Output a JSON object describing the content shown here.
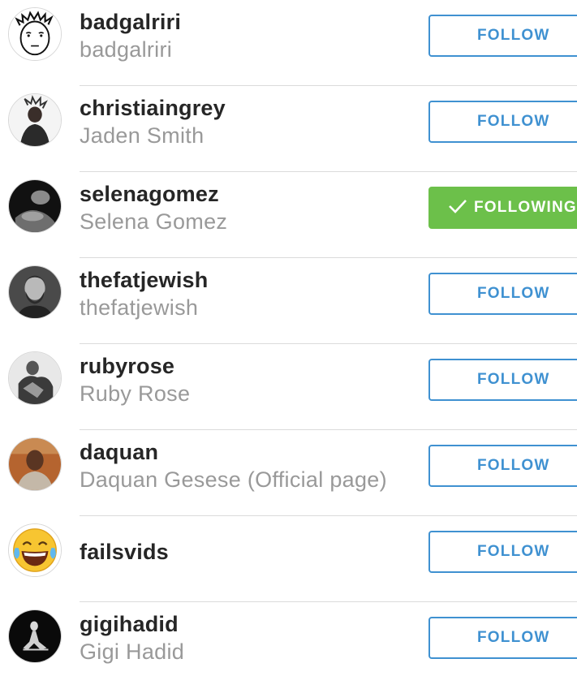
{
  "colors": {
    "follow_blue": "#3f91d1",
    "following_green": "#6cc04a",
    "username_text": "#262626",
    "fullname_text": "#999999",
    "divider": "#dbdbdb"
  },
  "users": [
    {
      "username": "badgalriri",
      "fullname": "badgalriri",
      "button": "FOLLOW",
      "following": false,
      "avatar": "rage-comic-face-icon"
    },
    {
      "username": "christiaingrey",
      "fullname": "Jaden Smith",
      "button": "FOLLOW",
      "following": false,
      "avatar": "profile-photo"
    },
    {
      "username": "selenagomez",
      "fullname": "Selena Gomez",
      "button": "FOLLOWING",
      "following": true,
      "avatar": "profile-photo"
    },
    {
      "username": "thefatjewish",
      "fullname": "thefatjewish",
      "button": "FOLLOW",
      "following": false,
      "avatar": "profile-photo"
    },
    {
      "username": "rubyrose",
      "fullname": "Ruby Rose",
      "button": "FOLLOW",
      "following": false,
      "avatar": "profile-photo"
    },
    {
      "username": "daquan",
      "fullname": "Daquan Gesese (Official page)",
      "button": "FOLLOW",
      "following": false,
      "avatar": "profile-photo"
    },
    {
      "username": "failsvids",
      "fullname": "",
      "button": "FOLLOW",
      "following": false,
      "avatar": "laughing-tears-emoji-icon"
    },
    {
      "username": "gigihadid",
      "fullname": "Gigi Hadid",
      "button": "FOLLOW",
      "following": false,
      "avatar": "profile-photo"
    }
  ],
  "check_icon": "checkmark-icon"
}
